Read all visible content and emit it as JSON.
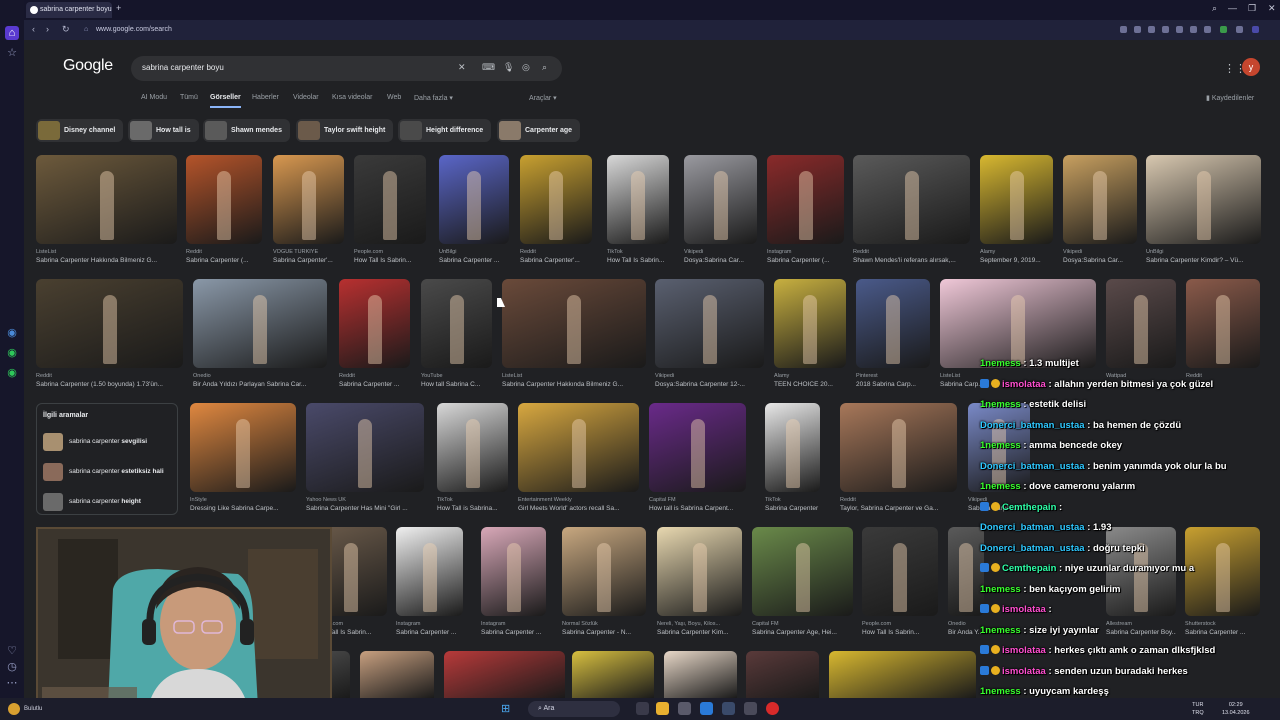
{
  "browser": {
    "tab_title": "sabrina carpenter boyu",
    "new_tab": "+",
    "url": "www.google.com/search"
  },
  "google": {
    "logo": "Google",
    "query": "sabrina carpenter boyu",
    "avatar_letter": "y",
    "nav_tabs": [
      "AI Modu",
      "Tümü",
      "Görseller",
      "Haberler",
      "Videolar",
      "Kısa videolar",
      "Web",
      "Daha fazla"
    ],
    "tools": "Araçlar",
    "saved": "Kaydedilenler"
  },
  "chips": [
    {
      "label": "Disney channel",
      "color": "#7a6a3a"
    },
    {
      "label": "How tall is",
      "color": "#6a6a6a"
    },
    {
      "label": "Shawn mendes",
      "color": "#5a5a5a"
    },
    {
      "label": "Taylor swift height",
      "color": "#6b5a4a"
    },
    {
      "label": "Height difference",
      "color": "#4a4a4a"
    },
    {
      "label": "Carpenter age",
      "color": "#8a7a6a"
    }
  ],
  "results": [
    {
      "src": "ListeList",
      "title": "Sabrina Carpenter Hakkında Bilmeniz G...",
      "color": "#6d5a3c"
    },
    {
      "src": "Reddit",
      "title": "Sabrina Carpenter (...",
      "color": "#b5542a"
    },
    {
      "src": "VOGUE TÜRKİYE",
      "title": "Sabrina Carpenter'...",
      "color": "#d89850"
    },
    {
      "src": "People.com",
      "title": "How Tall Is Sabrin...",
      "color": "#3a3a3a"
    },
    {
      "src": "ÜnBilgi",
      "title": "Sabrina Carpenter ...",
      "color": "#5a66c8"
    },
    {
      "src": "Reddit",
      "title": "Sabrina Carpenter'...",
      "color": "#c8a030"
    },
    {
      "src": "TikTok",
      "title": "How Tall Is Sabrin...",
      "color": "#d8d8d8"
    },
    {
      "src": "Vikipedi",
      "title": "Dosya:Sabrina Car...",
      "color": "#9a9aa0"
    },
    {
      "src": "Instagram",
      "title": "Sabrina Carpenter (...",
      "color": "#8a2a2a"
    },
    {
      "src": "Reddit",
      "title": "Shawn Mendes'li referans alırsak,...",
      "color": "#5a5a5a"
    },
    {
      "src": "Alamy",
      "title": "September 9, 2019...",
      "color": "#d8b830"
    },
    {
      "src": "Vikipedi",
      "title": "Dosya:Sabrina Car...",
      "color": "#c8a060"
    },
    {
      "src": "ÜnBilgi",
      "title": "Sabrina Carpenter Kimdir? – Vü...",
      "color": "#d8c8b0"
    },
    {
      "src": "Reddit",
      "title": "Sabrina Carpenter (1.50 boyunda) 1.73'ün...",
      "color": "#4a4030"
    },
    {
      "src": "Onedio",
      "title": "Bir Anda Yıldızı Parlayan Sabrina Car...",
      "color": "#8a98a8"
    },
    {
      "src": "Reddit",
      "title": "Sabrina Carpenter ...",
      "color": "#b83030"
    },
    {
      "src": "YouTube",
      "title": "How tall Sabrina C...",
      "color": "#4a4a4a"
    },
    {
      "src": "ListeList",
      "title": "Sabrina Carpenter Hakkında Bilmeniz G...",
      "color": "#6a4a3a"
    },
    {
      "src": "Vikipedi",
      "title": "Dosya:Sabrina Carpenter 12-...",
      "color": "#5a6070"
    },
    {
      "src": "Alamy",
      "title": "TEEN CHOICE 20...",
      "color": "#c8b040"
    },
    {
      "src": "Pinterest",
      "title": "2018 Sabrina Carp...",
      "color": "#4a5a8a"
    },
    {
      "src": "ListeList",
      "title": "Sabrina Carp...",
      "color": "#f0c8d8"
    },
    {
      "src": "Wattpad",
      "title": "",
      "color": "#5a4a4a"
    },
    {
      "src": "Reddit",
      "title": "",
      "color": "#8a5a4a"
    },
    {
      "src": "InStyle",
      "title": "Dressing Like Sabrina Carpe...",
      "color": "#e08840"
    },
    {
      "src": "Yahoo News UK",
      "title": "Sabrina Carpenter Has Mini \"Girl ...",
      "color": "#4a4a6a"
    },
    {
      "src": "TikTok",
      "title": "How Tall is Sabrina...",
      "color": "#d8d8d8"
    },
    {
      "src": "Entertainment Weekly",
      "title": "Girl Meets World' actors recall Sa...",
      "color": "#d8a840"
    },
    {
      "src": "Capital FM",
      "title": "How tall is Sabrina Carpent...",
      "color": "#6a2a8a"
    },
    {
      "src": "TikTok",
      "title": "Sabrina Carpenter ...",
      "color": "#e8e8e8"
    },
    {
      "src": "Reddit",
      "title": "Taylor, Sabrina Carpenter ve Ga...",
      "color": "#a8785a"
    },
    {
      "src": "Vikipedi",
      "title": "Sabrina Carpenter ...",
      "color": "#7a8ac8"
    },
    {
      "src": "People.com",
      "title": "How Tall Is Sabrin...",
      "color": "#6a5a4a"
    },
    {
      "src": "Instagram",
      "title": "Sabrina Carpenter ...",
      "color": "#f0f0f0"
    },
    {
      "src": "Instagram",
      "title": "Sabrina Carpenter ...",
      "color": "#d8a8b8"
    },
    {
      "src": "Normal Sözlük",
      "title": "Sabrina Carpenter - N...",
      "color": "#c8a880"
    },
    {
      "src": "Nereli, Yaşı, Boyu, Kilos...",
      "title": "Sabrina Carpenter Kim...",
      "color": "#e8d8b0"
    },
    {
      "src": "Capital FM",
      "title": "Sabrina Carpenter Age, Hei...",
      "color": "#6a8a4a"
    },
    {
      "src": "People.com",
      "title": "How Tall Is Sabrin...",
      "color": "#3a3a3a"
    },
    {
      "src": "Onedio",
      "title": "Bir Anda Y...",
      "color": "#5a5a5a"
    },
    {
      "src": "Allestream",
      "title": "Sabrina Carpenter Boy...",
      "color": "#8a8a8a"
    },
    {
      "src": "Shutterstock",
      "title": "Sabrina Carpenter ...",
      "color": "#c8a030"
    }
  ],
  "related": {
    "header": "İlgili aramalar",
    "items": [
      {
        "pre": "sabrina carpenter ",
        "bold": "sevgilisi",
        "color": "#a89070"
      },
      {
        "pre": "sabrina carpenter ",
        "bold": "estetiksiz hali",
        "color": "#8a6a5a"
      },
      {
        "pre": "sabrina carpenter ",
        "bold": "height",
        "color": "#6a6a6a"
      }
    ]
  },
  "chat": [
    {
      "user": "1nemess",
      "msg": ": 1.3 multijet",
      "ucolor": "#39ff2e",
      "badge": false
    },
    {
      "user": "ismolataa",
      "msg": ": allahın yerden bitmesi ya çok güzel",
      "ucolor": "#ff4fd0",
      "badge": true
    },
    {
      "user": "1nemess",
      "msg": ": estetik delisi",
      "ucolor": "#39ff2e",
      "badge": false
    },
    {
      "user": "Donerci_batman_ustaa",
      "msg": ": ba hemen de çözdü",
      "ucolor": "#2ec8ff",
      "badge": false
    },
    {
      "user": "1nemess",
      "msg": ": amma bencede okey",
      "ucolor": "#39ff2e",
      "badge": false
    },
    {
      "user": "Donerci_batman_ustaa",
      "msg": ": benim yanımda yok olur la bu",
      "ucolor": "#2ec8ff",
      "badge": false
    },
    {
      "user": "1nemess",
      "msg": ": dove cameronu yalarım",
      "ucolor": "#39ff2e",
      "badge": false
    },
    {
      "user": "Cemthepain",
      "msg": ":",
      "ucolor": "#2effa8",
      "badge": true
    },
    {
      "user": "Donerci_batman_ustaa",
      "msg": ": 1.93",
      "ucolor": "#2ec8ff",
      "badge": false
    },
    {
      "user": "Donerci_batman_ustaa",
      "msg": ": doğru tepki",
      "ucolor": "#2ec8ff",
      "badge": false
    },
    {
      "user": "Cemthepain",
      "msg": ": niye uzunlar duramıyor mu a",
      "ucolor": "#2effa8",
      "badge": true
    },
    {
      "user": "1nemess",
      "msg": ": ben kaçıyom gelirim",
      "ucolor": "#39ff2e",
      "badge": false
    },
    {
      "user": "ismolataa",
      "msg": ":",
      "ucolor": "#ff4fd0",
      "badge": true
    },
    {
      "user": "1nemess",
      "msg": ": size iyi yayınlar",
      "ucolor": "#39ff2e",
      "badge": false
    },
    {
      "user": "ismolataa",
      "msg": ": herkes çıktı amk o zaman dlksfjklsd",
      "ucolor": "#ff4fd0",
      "badge": true
    },
    {
      "user": "ismolataa",
      "msg": ": senden uzun buradaki herkes",
      "ucolor": "#ff4fd0",
      "badge": true
    },
    {
      "user": "1nemess",
      "msg": ": uyuycam kardeşş",
      "ucolor": "#39ff2e",
      "badge": false
    }
  ],
  "taskbar": {
    "weather": "Bulutlu",
    "search": "Ara",
    "lang_top": "TUR",
    "lang_bottom": "TRQ",
    "time": "02:29",
    "date": "13.04.2026"
  }
}
